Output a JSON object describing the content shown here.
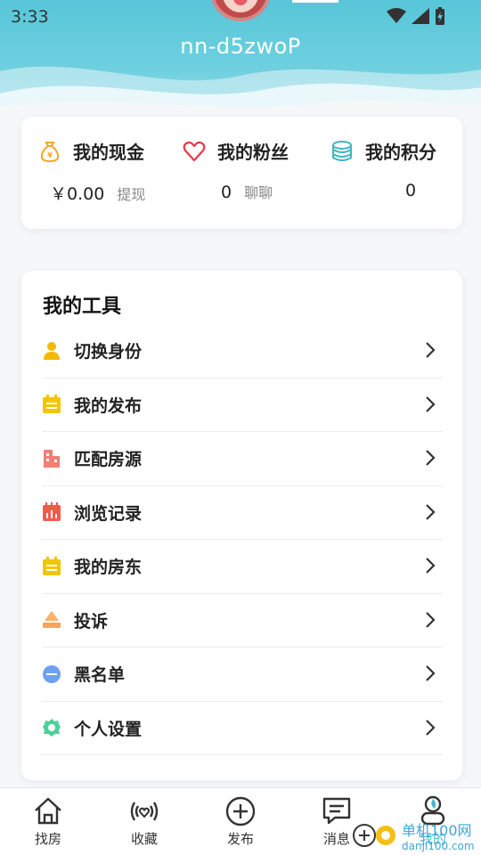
{
  "status_bar": {
    "time": "3:33"
  },
  "profile": {
    "username": "nn-d5zwoP"
  },
  "stats": [
    {
      "title": "我的现金",
      "icon": "money-bag-icon",
      "value": "￥0.00",
      "action": "提现"
    },
    {
      "title": "我的粉丝",
      "icon": "heart-icon",
      "value": "0",
      "action": "聊聊"
    },
    {
      "title": "我的积分",
      "icon": "coins-icon",
      "value": "0",
      "action": ""
    }
  ],
  "tools": {
    "title": "我的工具",
    "items": [
      {
        "label": "切换身份",
        "icon": "person-icon",
        "color": "#f5b800"
      },
      {
        "label": "我的发布",
        "icon": "calendar-icon",
        "color": "#f5c400"
      },
      {
        "label": "匹配房源",
        "icon": "building-icon",
        "color": "#f37e76"
      },
      {
        "label": "浏览记录",
        "icon": "chart-calendar-icon",
        "color": "#ef5b4b"
      },
      {
        "label": "我的房东",
        "icon": "calendar-icon",
        "color": "#f5c400"
      },
      {
        "label": "投诉",
        "icon": "tray-icon",
        "color": "#f9b26a"
      },
      {
        "label": "黑名单",
        "icon": "block-icon",
        "color": "#6e9ff2"
      },
      {
        "label": "个人设置",
        "icon": "gear-icon",
        "color": "#4fcf9a"
      }
    ]
  },
  "bottom_nav": [
    {
      "label": "找房",
      "icon": "home-icon"
    },
    {
      "label": "收藏",
      "icon": "broadcast-heart-icon"
    },
    {
      "label": "发布",
      "icon": "plus-circle-icon"
    },
    {
      "label": "消息",
      "icon": "chat-icon"
    },
    {
      "label": "我的",
      "icon": "user-icon"
    }
  ],
  "watermark": {
    "line1": "单机100网",
    "line2": "danji100.com"
  },
  "colors": {
    "accent": "#46b7d0",
    "header_start": "#57c6d8"
  }
}
